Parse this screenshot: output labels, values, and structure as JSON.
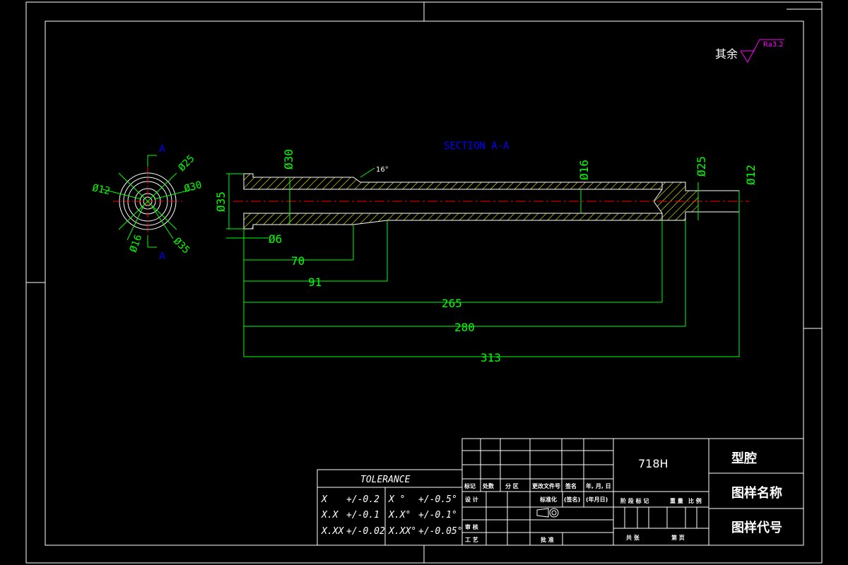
{
  "colors": {
    "bg": "#000000",
    "frame": "#ffffff",
    "dim": "#00ff00",
    "section": "#0000ff",
    "center": "#ff0000",
    "hatch": "#ffff00",
    "sheet": "#ffffff"
  },
  "surface": {
    "label": "其余",
    "roughness": "Ra3.2"
  },
  "section": {
    "title": "SECTION A-A",
    "mark": "A"
  },
  "end_view": {
    "d12": "Ø12",
    "d25": "Ø25",
    "d30": "Ø30",
    "d16": "Ø16",
    "d35": "Ø35"
  },
  "side_view": {
    "d30": "Ø30",
    "d35": "Ø35",
    "d16": "Ø16",
    "d25": "Ø25",
    "d12": "Ø12",
    "d6": "Ø6",
    "angle": "16°"
  },
  "lengths": {
    "l70": "70",
    "l91": "91",
    "l265": "265",
    "l280": "280",
    "l313": "313"
  },
  "tolerance": {
    "title": "TOLERANCE",
    "rows": [
      {
        "a": "X",
        "b": "+/-0.2",
        "c": "X °",
        "d": "+/-0.5°"
      },
      {
        "a": "X.X",
        "b": "+/-0.1",
        "c": "X.X°",
        "d": "+/-0.1°"
      },
      {
        "a": "X.XX",
        "b": "+/-0.02",
        "c": "X.XX°",
        "d": "+/-0.05°"
      }
    ]
  },
  "title_block": {
    "material": "718H",
    "part": "型腔",
    "drawing_name": "图样名称",
    "drawing_code": "图样代号",
    "h_mark": "标记",
    "h_count": "处数",
    "h_zone": "分 区",
    "h_change": "更改文件号",
    "h_sign": "签名",
    "h_date": "年, 月, 日",
    "design": "设 计",
    "standard": "标准化",
    "sign2": "(签名)",
    "date2": "(年月日)",
    "review": "审 核",
    "process": "工 艺",
    "approve": "批 准",
    "stage": "阶 段 标 记",
    "weight": "重 量",
    "scale": "比 例",
    "total": "共 张",
    "page": "第 页"
  }
}
